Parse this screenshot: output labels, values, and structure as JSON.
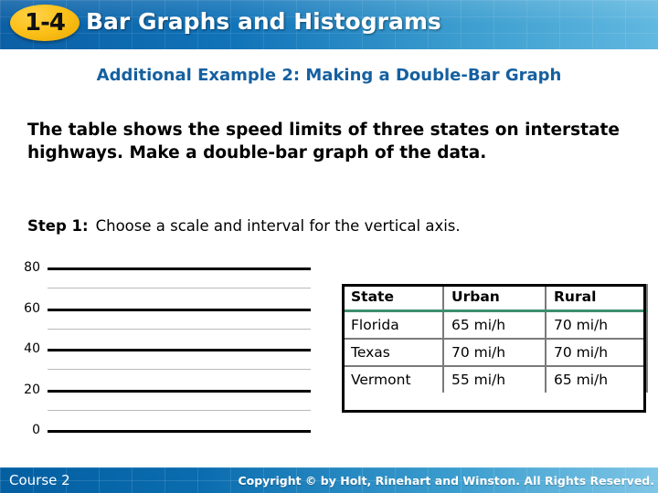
{
  "header": {
    "lesson_number": "1-4",
    "title": "Bar Graphs and Histograms"
  },
  "subtitle": "Additional Example 2: Making a Double-Bar Graph",
  "problem_text": "The table shows the speed limits of three states on interstate highways. Make a double-bar graph of the data.",
  "step": {
    "label": "Step 1:",
    "text": "Choose a scale and interval for the vertical axis."
  },
  "chart_data": {
    "type": "bar",
    "title": "",
    "xlabel": "",
    "ylabel": "",
    "ylim": [
      0,
      80
    ],
    "y_major_interval": 20,
    "y_minor_interval": 10,
    "y_tick_labels": [
      "80",
      "60",
      "40",
      "20",
      "0"
    ],
    "y_major_ticks": [
      80,
      60,
      40,
      20,
      0
    ],
    "y_minor_ticks": [
      70,
      50,
      30,
      10
    ],
    "grid": true,
    "legend_position": "none",
    "categories": [
      "Florida",
      "Texas",
      "Vermont"
    ],
    "series": [
      {
        "name": "Urban",
        "values": [
          65,
          70,
          55
        ]
      },
      {
        "name": "Rural",
        "values": [
          70,
          70,
          65
        ]
      }
    ],
    "bars_drawn": false
  },
  "table": {
    "columns": [
      "State",
      "Urban",
      "Rural"
    ],
    "rows": [
      [
        "Florida",
        "65 mi/h",
        "70 mi/h"
      ],
      [
        "Texas",
        "70 mi/h",
        "70 mi/h"
      ],
      [
        "Vermont",
        "55 mi/h",
        "65 mi/h"
      ]
    ]
  },
  "footer": {
    "course": "Course 2",
    "copyright": "Copyright © by Holt, Rinehart and Winston. All Rights Reserved."
  },
  "colors": {
    "header_blue_dark": "#0b5fa5",
    "header_blue_light": "#61b8e0",
    "badge_gold": "#fcc21b",
    "subtitle_blue": "#1560a0",
    "table_header_rule_green": "#3e8e6e",
    "gridline_major": "#000000",
    "gridline_minor": "#b9b9b9"
  }
}
